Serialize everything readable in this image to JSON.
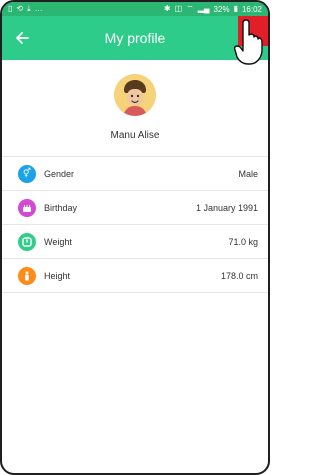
{
  "status_bar": {
    "left_icons": [
      "sim-icon",
      "sync-icon",
      "download-icon",
      "more-icon"
    ],
    "right_text": "32%",
    "time": "16:02"
  },
  "app_bar": {
    "title": "My profile",
    "bar_color": "#2ecc8a",
    "action_button_color": "#e21e29"
  },
  "profile": {
    "name": "Manu Alise"
  },
  "rows": [
    {
      "icon": "gender-icon",
      "label": "Gender",
      "value": "Male",
      "color": "#1aa3e8"
    },
    {
      "icon": "birthday-cake-icon",
      "label": "Birthday",
      "value": "1 January 1991",
      "color": "#d34ad2"
    },
    {
      "icon": "weight-icon",
      "label": "Weight",
      "value": "71.0 kg",
      "color": "#2fcf8a"
    },
    {
      "icon": "height-icon",
      "label": "Height",
      "value": "178.0 cm",
      "color": "#ff8c1a"
    }
  ]
}
